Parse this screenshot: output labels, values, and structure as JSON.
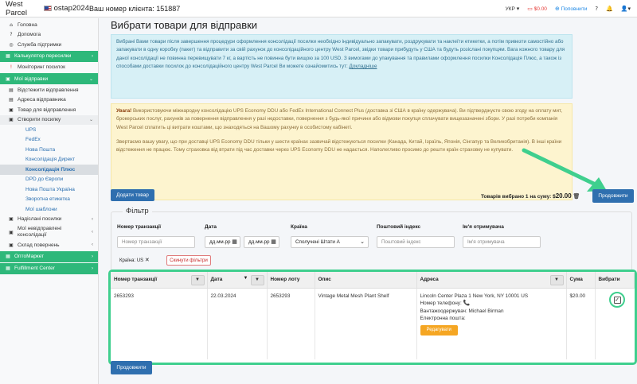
{
  "topbar": {
    "brand": "West Parcel",
    "username": "ostap2024",
    "client_label": "Ваш номер клієнта: 151887",
    "lang": "УКР",
    "balance": "$0.00",
    "topup": "Поповнити"
  },
  "sidebar": {
    "items": [
      {
        "label": "Головна"
      },
      {
        "label": "Допомога"
      },
      {
        "label": "Служба підтримки"
      },
      {
        "label": "Калькулятор пересилки"
      },
      {
        "label": "Моніторинг посилок"
      },
      {
        "label": "Мої відправки"
      },
      {
        "label": "Відстежити відправлення"
      },
      {
        "label": "Адреса відправника"
      },
      {
        "label": "Товар для відправлення"
      },
      {
        "label": "Створити посилку"
      },
      {
        "label": "UPS"
      },
      {
        "label": "FedEx"
      },
      {
        "label": "Нова Пошта"
      },
      {
        "label": "Консолідація Директ"
      },
      {
        "label": "Консолідація Плюс"
      },
      {
        "label": "DPD до Європи"
      },
      {
        "label": "Нова Пошта Україна"
      },
      {
        "label": "Зворотна етикетка"
      },
      {
        "label": "Мої шаблони"
      },
      {
        "label": "Надіслані посилки"
      },
      {
        "label": "Мої невідправлені консолідації"
      },
      {
        "label": "Склад повернень"
      },
      {
        "label": "ОптоМаркет"
      },
      {
        "label": "Fulfillment Center"
      }
    ]
  },
  "page": {
    "title": "Вибрати товари для відправки",
    "info_text": "Вибрані Вами товари після завершення процедури оформлення консолідації посилки необхідно індивідуально запакувати, роздрукувати та наклеїти етикетки, а потім привезти самостійно або запакувати в одну коробку (пакет) та відправити за свій рахунок до консолідаційного центру West Parcel, звідки товари прибудуть у США та будуть розіслані покупцям. Вага кожного товару для даної консолідації не повинна перевищувати 7 кг, а вартість не повинна бути вищою за 100 USD. З вимогами до упакування та правилами оформлення посилки Консолідація Плюс, а також із способами доставки посилок до консолідаційного центру West Parcel Ви можете ознайомитись тут:",
    "info_link": "Докладніше",
    "warn_bold": "Увага!",
    "warn_text1": "Використовуючи міжнародну консолідацію UPS Economy DDU або FedEx International Connect Plus (доставка зі США в країну одержувача). Ви підтверджуєте свою згоду на оплату мит, брокерських послуг, рахунків за повернення відправлення у разі недоставки, повернення з будь-якої причини або відмови покупця сплачувати вищезазначені збори. У разі потреби компанія West Parcel сплатить ці витрати коштами, що знаходяться на Вашому рахунку в особистому кабінеті.",
    "warn_text2": "Звертаємо вашу увагу, що при доставці UPS Economy DDU тільки у шести країнах зазвичай відстежуються посилки (Канада, Китай, Ізраїль, Японія, Сінгапур та Великобританія). В інші країни відстеження не працює. Тому страховка від втрати під час доставки через UPS Economy DDU не надається. Наполегливо просимо до решти країн страховку не купувати.",
    "add_button": "Додати товар",
    "selected_prefix": "Товарів вибрано 1 на суму: $",
    "selected_amount": "20.00",
    "continue_button": "Продовжити"
  },
  "filter": {
    "title": "Фільтр",
    "labels": {
      "transaction": "Номер транзакції",
      "date": "Дата",
      "country": "Країна",
      "postcode": "Поштовий індекс",
      "recipient": "Ім'я отримувача"
    },
    "placeholders": {
      "transaction": "Номер транзакції",
      "date_from": "дд.мм.рр",
      "date_to": "дд.мм.рр",
      "postcode": "Поштовий індекс",
      "recipient": "Ім'я отримувача"
    },
    "country_value": "Сполучені Штати А",
    "chip": "Країна: US",
    "reset_button": "Скинути фільтри"
  },
  "table": {
    "headers": [
      "Номер транзакції",
      "Дата",
      "Номер лоту",
      "Опис",
      "Адреса",
      "Сума",
      "Вибрати"
    ],
    "row": {
      "transaction": "2653293",
      "date": "22.03.2024",
      "lot": "2653293",
      "description": "Vintage Metal Mesh Plant Shelf",
      "address_line": "Lincoln Center Plaza 1 New York, NY 10001 US",
      "phone_label": "Номер телефону:",
      "consignee": "Вантажоодержувач: Michael Birman",
      "email_label": "Електронна пошта:",
      "edit_button": "Редагувати",
      "amount": "$20.00"
    }
  },
  "colors": {
    "accent": "#2eb87a",
    "primary": "#2f6faf",
    "highlight": "#3fcf8e"
  }
}
